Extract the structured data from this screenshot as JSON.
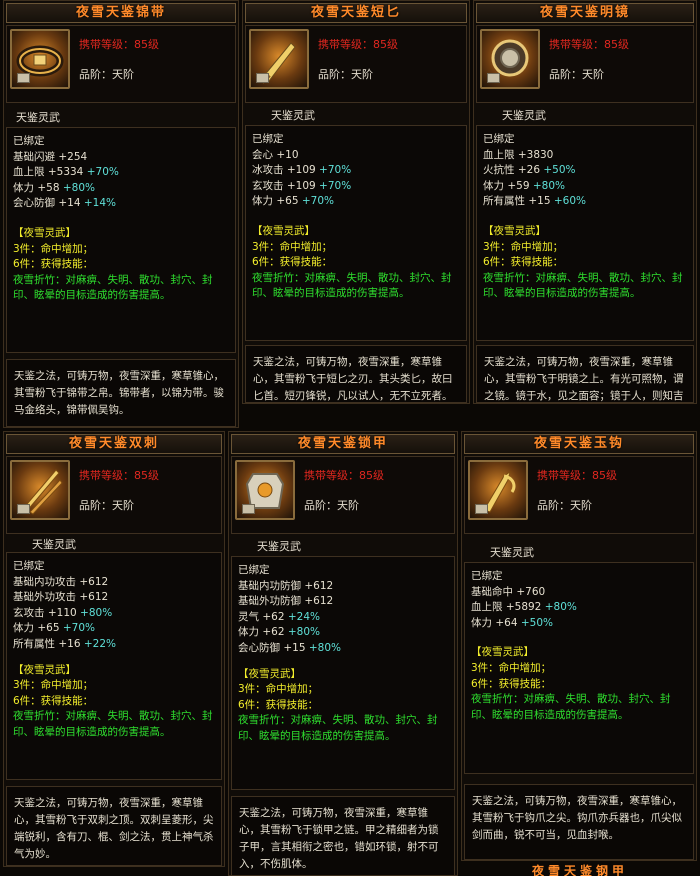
{
  "common": {
    "req_label": "携带等级：85级",
    "grade_label": "品阶：天阶",
    "section_label": "天鉴灵武",
    "bound_label": "已绑定",
    "set_title": "【夜雪灵武】",
    "set3": "3件：命中增加；",
    "set6": "6件：获得技能：",
    "skill": "夜雪折竹：对麻痹、失明、散功、封穴、封印、眩晕的目标造成的伤害提高。"
  },
  "items": [
    {
      "name": "夜雪天鉴锦带",
      "icon": "belt-icon",
      "stats": [
        {
          "name": "基础闪避",
          "value": "+254",
          "bonus": ""
        },
        {
          "name": "血上限",
          "value": "+5334",
          "bonus": "+70%"
        },
        {
          "name": "体力",
          "value": "+58",
          "bonus": "+80%"
        },
        {
          "name": "会心防御",
          "value": "+14",
          "bonus": "+14%"
        }
      ],
      "desc": "天鉴之法，可铸万物，夜雪深重，寒草锥心，其雪粉飞于锦带之帛。锦带者，以锦为带。骏马金络头，锦带佩吴钩。"
    },
    {
      "name": "夜雪天鉴短匕",
      "icon": "dagger-icon",
      "stats": [
        {
          "name": "会心",
          "value": "+10",
          "bonus": ""
        },
        {
          "name": "冰攻击",
          "value": "+109",
          "bonus": "+70%"
        },
        {
          "name": "玄攻击",
          "value": "+109",
          "bonus": "+70%"
        },
        {
          "name": "体力",
          "value": "+65",
          "bonus": "+70%"
        }
      ],
      "desc": "天鉴之法，可铸万物，夜雪深重，寒草锥心，其雪粉飞于短匕之刃。其头类匕，故曰匕首。短刃锋锐，凡以试人，无不立死者。"
    },
    {
      "name": "夜雪天鉴明镜",
      "icon": "mirror-icon",
      "stats": [
        {
          "name": "血上限",
          "value": "+3830",
          "bonus": ""
        },
        {
          "name": "火抗性",
          "value": "+26",
          "bonus": "+50%"
        },
        {
          "name": "体力",
          "value": "+59",
          "bonus": "+80%"
        },
        {
          "name": "所有属性",
          "value": "+15",
          "bonus": "+60%"
        }
      ],
      "desc": "天鉴之法，可铸万物，夜雪深重，寒草锥心，其雪粉飞于明镜之上。有光可照物，谓之镜。镜于水，见之面容；镜于人，则知吉与凶。"
    },
    {
      "name": "夜雪天鉴双刺",
      "icon": "twin-blade-icon",
      "stats": [
        {
          "name": "基础内功攻击",
          "value": "+612",
          "bonus": ""
        },
        {
          "name": "基础外功攻击",
          "value": "+612",
          "bonus": ""
        },
        {
          "name": "玄攻击",
          "value": "+110",
          "bonus": "+80%"
        },
        {
          "name": "体力",
          "value": "+65",
          "bonus": "+70%"
        },
        {
          "name": "所有属性",
          "value": "+16",
          "bonus": "+22%"
        }
      ],
      "desc": "天鉴之法，可铸万物，夜雪深重，寒草锥心，其雪粉飞于双刺之顶。双刺呈菱形，尖端锐利，含有刀、棍、剑之法，贯上神气杀气为妙。"
    },
    {
      "name": "夜雪天鉴锁甲",
      "icon": "armor-icon",
      "stats": [
        {
          "name": "基础内功防御",
          "value": "+612",
          "bonus": ""
        },
        {
          "name": "基础外功防御",
          "value": "+612",
          "bonus": ""
        },
        {
          "name": "灵气",
          "value": "+62",
          "bonus": "+24%"
        },
        {
          "name": "体力",
          "value": "+62",
          "bonus": "+80%"
        },
        {
          "name": "会心防御",
          "value": "+15",
          "bonus": "+80%"
        }
      ],
      "desc": "天鉴之法，可铸万物，夜雪深重，寒草锥心，其雪粉飞于锁甲之链。甲之精细者为锁子甲，言其相衔之密也，错如环锁，射不可入，不伤肌体。"
    },
    {
      "name": "夜雪天鉴玉钩",
      "icon": "claw-icon",
      "stats": [
        {
          "name": "基础命中",
          "value": "+760",
          "bonus": ""
        },
        {
          "name": "血上限",
          "value": "+5892",
          "bonus": "+80%"
        },
        {
          "name": "体力",
          "value": "+64",
          "bonus": "+50%"
        }
      ],
      "desc": "天鉴之法，可铸万物，夜雪深重，寒草锥心，其雪粉飞于钩爪之尖。钩爪亦兵器也，爪尖似剑而曲，锐不可当，见血封喉。"
    }
  ],
  "bottom_partial_title": "夜雪天鉴钢甲"
}
